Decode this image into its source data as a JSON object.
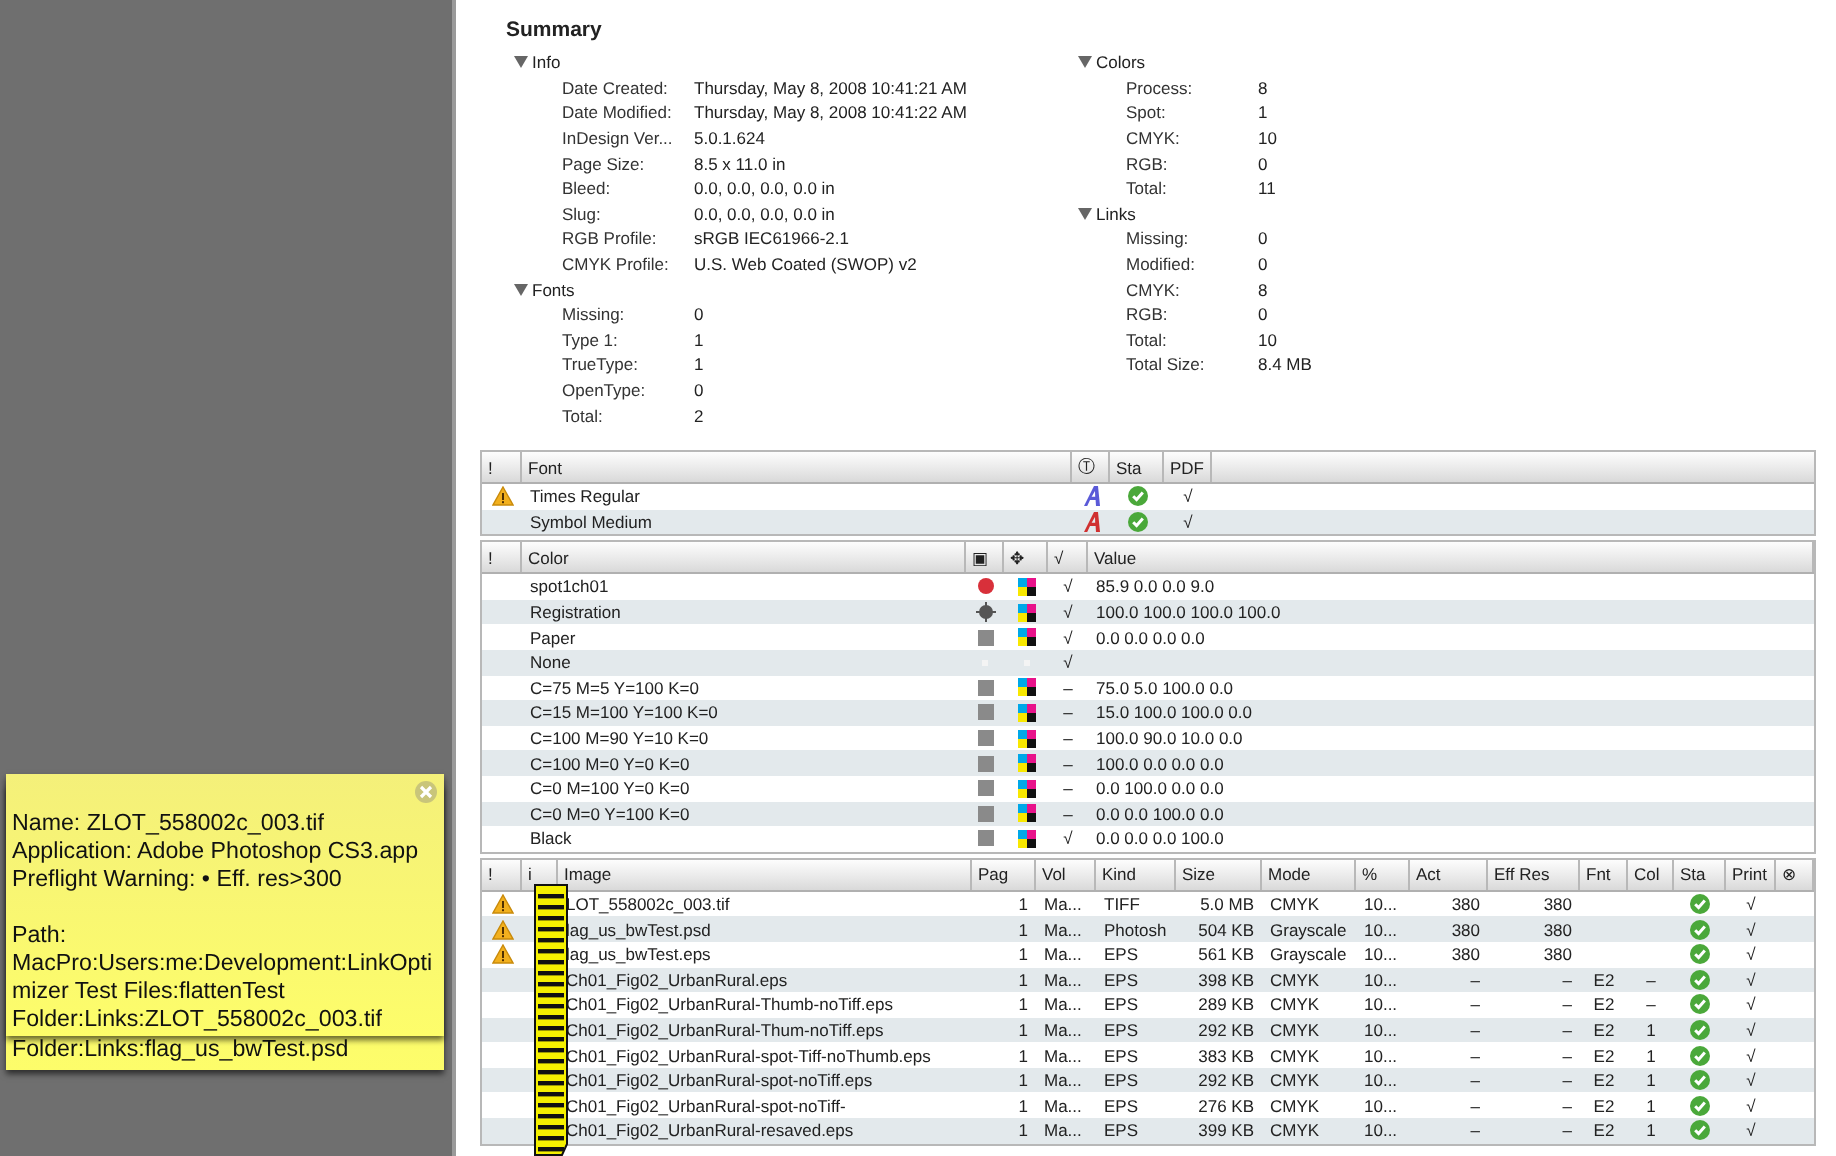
{
  "tooltips": [
    {
      "paragraphs": [
        [
          "Name: ZLOT_558002c_003.tif",
          "Application: Adobe Photoshop CS3.app",
          "Preflight Warning: • Eff. res>300"
        ],
        [
          "Path:",
          "MacPro:Users:me:Development:LinkOpti",
          "mizer Test Files:flattenTest",
          "Folder:Links:ZLOT_558002c_003.tif"
        ]
      ],
      "closable": true
    },
    {
      "paragraphs": [
        [
          "Folder:Links:flag_us_bwTest.psd"
        ]
      ]
    }
  ],
  "summary": {
    "title": "Summary",
    "columns": [
      [
        {
          "title": "Info",
          "expanded": true,
          "items": [
            {
              "label": "Date Created:",
              "value": "Thursday, May 8, 2008 10:41:21 AM"
            },
            {
              "label": "Date Modified:",
              "value": "Thursday, May 8, 2008 10:41:22 AM"
            },
            {
              "label": "InDesign Ver...",
              "value": "5.0.1.624"
            },
            {
              "label": "Page Size:",
              "value": "8.5 x 11.0 in"
            },
            {
              "label": "Bleed:",
              "value": "0.0, 0.0, 0.0, 0.0 in"
            },
            {
              "label": "Slug:",
              "value": "0.0, 0.0, 0.0, 0.0 in"
            },
            {
              "label": "RGB Profile:",
              "value": "sRGB IEC61966-2.1"
            },
            {
              "label": "CMYK Profile:",
              "value": "U.S. Web Coated (SWOP) v2"
            }
          ]
        },
        {
          "title": "Fonts",
          "expanded": true,
          "items": [
            {
              "label": "Missing:",
              "value": "0"
            },
            {
              "label": "Type 1:",
              "value": "1"
            },
            {
              "label": "TrueType:",
              "value": "1"
            },
            {
              "label": "OpenType:",
              "value": "0"
            },
            {
              "label": "Total:",
              "value": "2"
            }
          ]
        }
      ],
      [
        {
          "title": "Colors",
          "expanded": true,
          "items": [
            {
              "label": "Process:",
              "value": "8"
            },
            {
              "label": "Spot:",
              "value": "1"
            },
            {
              "label": "CMYK:",
              "value": "10"
            },
            {
              "label": "RGB:",
              "value": "0"
            },
            {
              "label": "Total:",
              "value": "11"
            }
          ]
        },
        {
          "title": "Links",
          "expanded": true,
          "items": [
            {
              "label": "Missing:",
              "value": "0"
            },
            {
              "label": "Modified:",
              "value": "0"
            },
            {
              "label": "CMYK:",
              "value": "8"
            },
            {
              "label": "RGB:",
              "value": "0"
            },
            {
              "label": "Total:",
              "value": "10"
            },
            {
              "label": "Total Size:",
              "value": "8.4 MB"
            }
          ]
        }
      ]
    ]
  },
  "fonts": {
    "columns": [
      "!",
      "Font",
      "Ⓣ",
      "Sta",
      "PDF"
    ],
    "rows": [
      {
        "warning": true,
        "name": "Times Regular",
        "kind": "type1",
        "status_ok": true,
        "pdf": "√"
      },
      {
        "warning": false,
        "name": "Symbol Medium",
        "kind": "truetype",
        "status_ok": true,
        "pdf": "√"
      }
    ]
  },
  "colors": {
    "columns": [
      "!",
      "Color",
      "▣",
      "✥",
      "√",
      "Value"
    ],
    "rows": [
      {
        "name": "spot1ch01",
        "kind": "spot",
        "cmyk": true,
        "used": "√",
        "value": "85.9  0.0  0.0  9.0"
      },
      {
        "name": "Registration",
        "kind": "registration",
        "cmyk": true,
        "used": "√",
        "value": "100.0  100.0  100.0  100.0"
      },
      {
        "name": "Paper",
        "kind": "process",
        "cmyk": true,
        "used": "√",
        "value": "0.0  0.0  0.0  0.0"
      },
      {
        "name": "None",
        "kind": "none",
        "cmyk": false,
        "used": "√"
      },
      {
        "name": "C=75 M=5 Y=100 K=0",
        "kind": "process",
        "cmyk": true,
        "used": "–",
        "value": "75.0  5.0  100.0  0.0"
      },
      {
        "name": "C=15 M=100 Y=100 K=0",
        "kind": "process",
        "cmyk": true,
        "used": "–",
        "value": "15.0  100.0  100.0  0.0"
      },
      {
        "name": "C=100 M=90 Y=10 K=0",
        "kind": "process",
        "cmyk": true,
        "used": "–",
        "value": "100.0  90.0  10.0  0.0"
      },
      {
        "name": "C=100 M=0 Y=0 K=0",
        "kind": "process",
        "cmyk": true,
        "used": "–",
        "value": "100.0  0.0  0.0  0.0"
      },
      {
        "name": "C=0 M=100 Y=0 K=0",
        "kind": "process",
        "cmyk": true,
        "used": "–",
        "value": "0.0  100.0  0.0  0.0"
      },
      {
        "name": "C=0 M=0 Y=100 K=0",
        "kind": "process",
        "cmyk": true,
        "used": "–",
        "value": "0.0  0.0  100.0  0.0"
      },
      {
        "name": "Black",
        "kind": "process",
        "cmyk": true,
        "used": "√",
        "value": "0.0  0.0  0.0  100.0"
      }
    ]
  },
  "images": {
    "columns": [
      "!",
      "i",
      "Image",
      "Pag",
      "Vol",
      "Kind",
      "Size",
      "Mode",
      "%",
      "Act",
      "Eff Res",
      "Fnt",
      "Col",
      "Sta",
      "Print",
      "⊗"
    ],
    "rows": [
      {
        "warning": true,
        "name": "LOT_558002c_003.tif",
        "page": "1",
        "volume": "Ma...",
        "kind": "TIFF",
        "size": "5.0 MB",
        "mode": "CMYK",
        "scale": "10...",
        "actual": "380",
        "effective": "380",
        "status_ok": true,
        "print": "√"
      },
      {
        "warning": true,
        "name": "lag_us_bwTest.psd",
        "page": "1",
        "volume": "Ma...",
        "kind": "Photosh",
        "size": "504 KB",
        "mode": "Grayscale",
        "scale": "10...",
        "actual": "380",
        "effective": "380",
        "status_ok": true,
        "print": "√"
      },
      {
        "warning": true,
        "name": "lag_us_bwTest.eps",
        "page": "1",
        "volume": "Ma...",
        "kind": "EPS",
        "size": "561 KB",
        "mode": "Grayscale",
        "scale": "10...",
        "actual": "380",
        "effective": "380",
        "status_ok": true,
        "print": "√"
      },
      {
        "warning": false,
        "name": "Ch01_Fig02_UrbanRural.eps",
        "page": "1",
        "volume": "Ma...",
        "kind": "EPS",
        "size": "398 KB",
        "mode": "CMYK",
        "scale": "10...",
        "actual": "–",
        "effective": "–",
        "fonts": "E2",
        "colors": "–",
        "status_ok": true,
        "print": "√"
      },
      {
        "warning": false,
        "name": "Ch01_Fig02_UrbanRural-Thumb-noTiff.eps",
        "page": "1",
        "volume": "Ma...",
        "kind": "EPS",
        "size": "289 KB",
        "mode": "CMYK",
        "scale": "10...",
        "actual": "–",
        "effective": "–",
        "fonts": "E2",
        "colors": "–",
        "status_ok": true,
        "print": "√"
      },
      {
        "warning": false,
        "name": "Ch01_Fig02_UrbanRural-Thum-noTiff.eps",
        "page": "1",
        "volume": "Ma...",
        "kind": "EPS",
        "size": "292 KB",
        "mode": "CMYK",
        "scale": "10...",
        "actual": "–",
        "effective": "–",
        "fonts": "E2",
        "colors": "1",
        "status_ok": true,
        "print": "√"
      },
      {
        "warning": false,
        "name": "Ch01_Fig02_UrbanRural-spot-Tiff-noThumb.eps",
        "page": "1",
        "volume": "Ma...",
        "kind": "EPS",
        "size": "383 KB",
        "mode": "CMYK",
        "scale": "10...",
        "actual": "–",
        "effective": "–",
        "fonts": "E2",
        "colors": "1",
        "status_ok": true,
        "print": "√"
      },
      {
        "warning": false,
        "name": "Ch01_Fig02_UrbanRural-spot-noTiff.eps",
        "page": "1",
        "volume": "Ma...",
        "kind": "EPS",
        "size": "292 KB",
        "mode": "CMYK",
        "scale": "10...",
        "actual": "–",
        "effective": "–",
        "fonts": "E2",
        "colors": "1",
        "status_ok": true,
        "print": "√"
      },
      {
        "warning": false,
        "name": "Ch01_Fig02_UrbanRural-spot-noTiff-",
        "page": "1",
        "volume": "Ma...",
        "kind": "EPS",
        "size": "276 KB",
        "mode": "CMYK",
        "scale": "10...",
        "actual": "–",
        "effective": "–",
        "fonts": "E2",
        "colors": "1",
        "status_ok": true,
        "print": "√"
      },
      {
        "warning": false,
        "name": "Ch01_Fig02_UrbanRural-resaved.eps",
        "page": "1",
        "volume": "Ma...",
        "kind": "EPS",
        "size": "399 KB",
        "mode": "CMYK",
        "scale": "10...",
        "actual": "–",
        "effective": "–",
        "fonts": "E2",
        "colors": "1",
        "status_ok": true,
        "print": "√"
      }
    ]
  }
}
